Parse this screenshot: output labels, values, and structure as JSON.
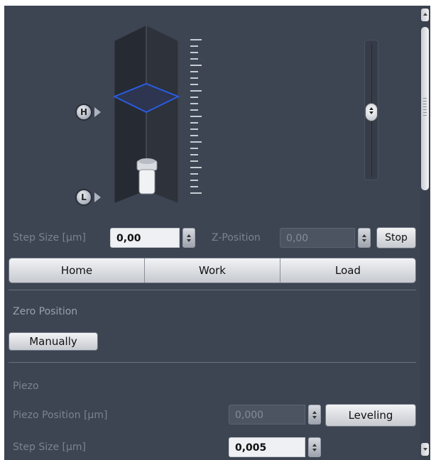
{
  "focus_control": {
    "high_marker": "H",
    "low_marker": "L"
  },
  "drive": {
    "step_size_label": "Step Size [µm]",
    "step_size_value": "0,00",
    "z_position_label": "Z-Position",
    "z_position_value": "0,00",
    "stop_label": "Stop"
  },
  "positions": [
    "Home",
    "Work",
    "Load"
  ],
  "zero_position": {
    "heading": "Zero Position",
    "manually_label": "Manually"
  },
  "piezo": {
    "heading": "Piezo",
    "position_label": "Piezo Position [µm]",
    "position_value": "0,000",
    "leveling_label": "Leveling",
    "step_size_label": "Step Size [µm]",
    "step_size_value": "0,005"
  }
}
